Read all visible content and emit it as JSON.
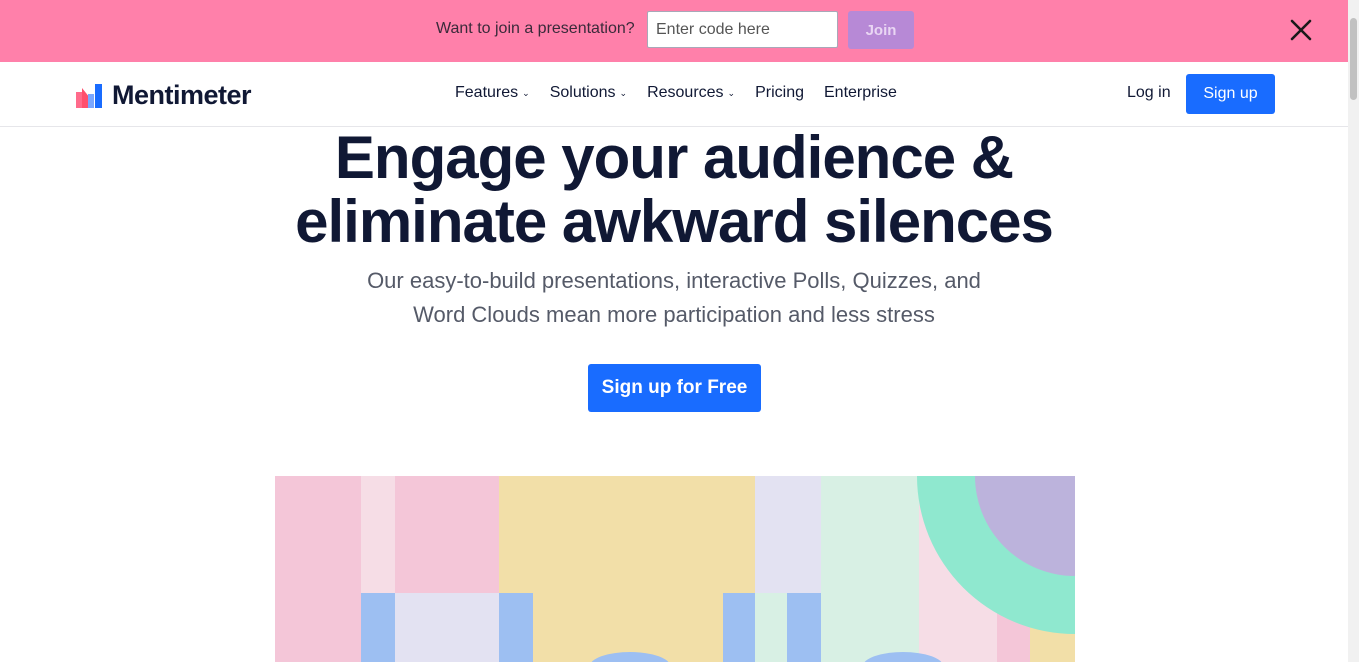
{
  "banner": {
    "prompt": "Want to join a presentation?",
    "code_placeholder": "Enter code here",
    "join_label": "Join",
    "close_icon": "close-icon"
  },
  "nav": {
    "brand": "Mentimeter",
    "links": [
      {
        "label": "Features",
        "has_dropdown": true
      },
      {
        "label": "Solutions",
        "has_dropdown": true
      },
      {
        "label": "Resources",
        "has_dropdown": true
      },
      {
        "label": "Pricing",
        "has_dropdown": false
      },
      {
        "label": "Enterprise",
        "has_dropdown": false
      }
    ],
    "login_label": "Log in",
    "signup_label": "Sign up"
  },
  "hero": {
    "title_line1": "Engage your audience &",
    "title_line2": "eliminate awkward silences",
    "subtitle_line1": "Our easy-to-build presentations, interactive Polls, Quizzes, and",
    "subtitle_line2": "Word Clouds mean more participation and less stress",
    "cta_label": "Sign up for Free"
  },
  "colors": {
    "banner": "#ff80aa",
    "primary": "#196cff",
    "join_button": "#b789d6",
    "text_dark": "#101834"
  }
}
